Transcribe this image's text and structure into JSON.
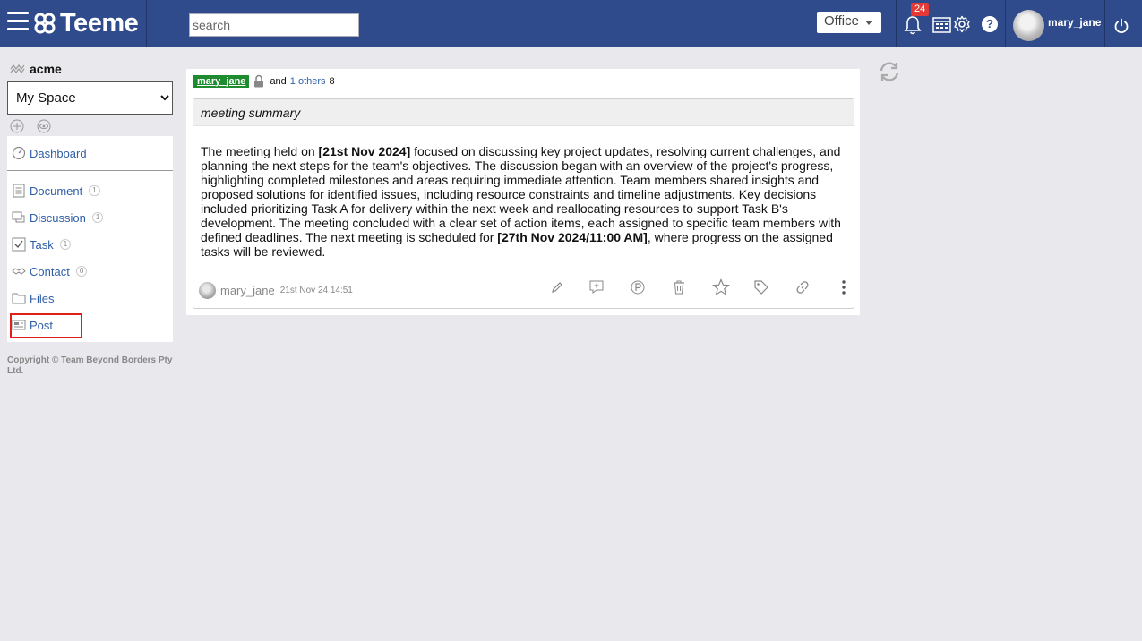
{
  "header": {
    "app_name": "Teeme",
    "search_placeholder": "search",
    "office_label": "Office",
    "notification_count": "24",
    "help_label": "?",
    "username": "mary_jane"
  },
  "sidebar": {
    "org_name": "acme",
    "space_options": [
      "My Space"
    ],
    "selected_space": "My Space",
    "items": [
      {
        "label": "Dashboard",
        "icon": "dashboard-icon"
      },
      {
        "label": "Document",
        "count": "1",
        "icon": "document-icon"
      },
      {
        "label": "Discussion",
        "count": "1",
        "icon": "discussion-icon"
      },
      {
        "label": "Task",
        "count": "1",
        "icon": "task-icon"
      },
      {
        "label": "Contact",
        "count": "0",
        "icon": "contact-icon"
      },
      {
        "label": "Files",
        "icon": "folder-icon"
      },
      {
        "label": "Post",
        "icon": "post-icon"
      }
    ],
    "copyright": "Copyright © Team Beyond Borders Pty Ltd."
  },
  "post": {
    "user_tag": "mary_jane",
    "and_text": "and",
    "others_text": "1 others",
    "count_text": "8",
    "title": "meeting summary",
    "body": {
      "p1": "The meeting held on ",
      "b1": "[21st Nov 2024]",
      "p2": " focused on discussing key project updates, resolving current challenges, and planning the next steps for the team's objectives. The discussion began with an overview of the project's progress, highlighting completed milestones and areas requiring immediate attention. Team members shared insights and proposed solutions for identified issues, including resource constraints and timeline adjustments. Key decisions included prioritizing Task A for delivery within the next week and reallocating resources to support Task B's development. The meeting concluded with a clear set of action items, each assigned to specific team members with defined deadlines. The next meeting is scheduled for ",
      "b2": "[27th Nov 2024/11:00 AM]",
      "p3": ", where progress on the assigned tasks will be reviewed."
    },
    "author": "mary_jane",
    "date": "21st Nov 24 14:51"
  },
  "colors": {
    "header_bg": "#2f4b8c",
    "link": "#2f5ea8",
    "user_tag_bg": "#1e8b2f",
    "badge": "#e53935",
    "highlight_border": "#e0201b"
  }
}
